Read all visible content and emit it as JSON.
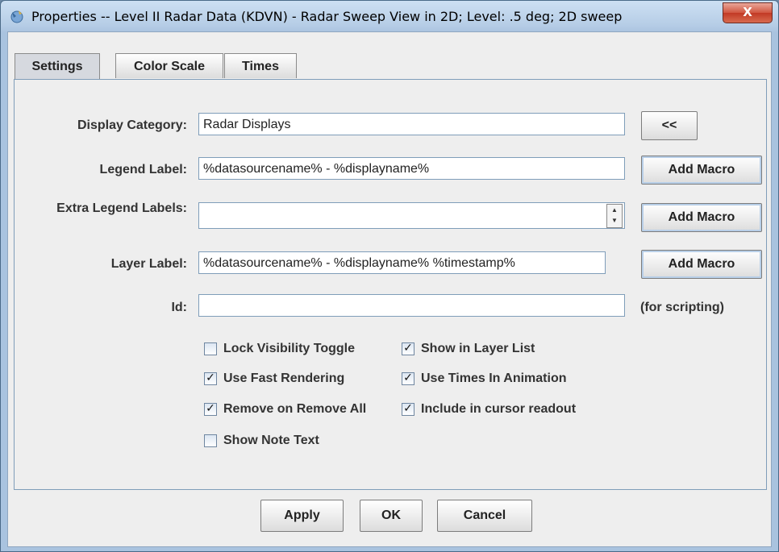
{
  "window": {
    "title": "Properties -- Level II Radar Data (KDVN) - Radar Sweep View in 2D; Level: .5 deg; 2D sweep",
    "close_label": "X"
  },
  "tabs": [
    {
      "label": "Settings",
      "active": true
    },
    {
      "label": "Color Scale",
      "active": false
    },
    {
      "label": "Times",
      "active": false
    }
  ],
  "settings": {
    "display_category": {
      "label": "Display Category:",
      "value": "Radar Displays",
      "button": "<<"
    },
    "legend_label": {
      "label": "Legend Label:",
      "value": "%datasourcename% - %displayname%",
      "button": "Add Macro"
    },
    "extra_legend": {
      "label": "Extra Legend Labels:",
      "value": "",
      "button": "Add Macro"
    },
    "layer_label": {
      "label": "Layer Label:",
      "value": "%datasourcename% - %displayname% %timestamp%",
      "button": "Add Macro"
    },
    "id": {
      "label": "Id:",
      "value": "",
      "note": "(for scripting)"
    }
  },
  "checkboxes": [
    {
      "label": "Lock Visibility Toggle",
      "checked": false
    },
    {
      "label": "Show in Layer List",
      "checked": true
    },
    {
      "label": "Use Fast Rendering",
      "checked": true
    },
    {
      "label": "Use Times In Animation",
      "checked": true
    },
    {
      "label": "Remove on Remove All",
      "checked": true
    },
    {
      "label": "Include in cursor readout",
      "checked": true
    },
    {
      "label": "Show Note Text",
      "checked": false
    }
  ],
  "check_mark": "✓",
  "footer": {
    "apply": "Apply",
    "ok": "OK",
    "cancel": "Cancel"
  }
}
